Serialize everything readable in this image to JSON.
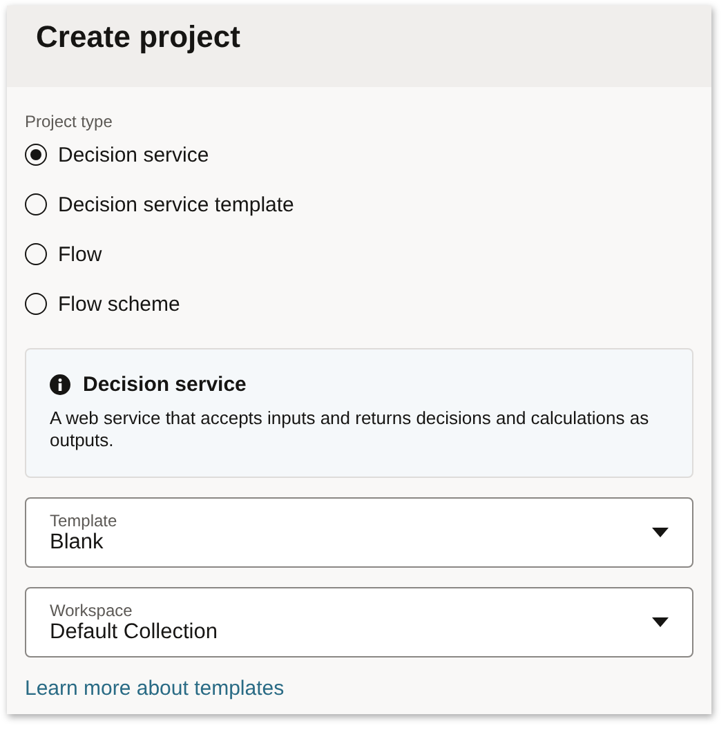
{
  "dialog": {
    "title": "Create project"
  },
  "project_type": {
    "label": "Project type",
    "options": [
      {
        "label": "Decision service",
        "selected": true
      },
      {
        "label": "Decision service template",
        "selected": false
      },
      {
        "label": "Flow",
        "selected": false
      },
      {
        "label": "Flow scheme",
        "selected": false
      }
    ]
  },
  "info": {
    "title": "Decision service",
    "text": "A web service that accepts inputs and returns decisions and calculations as outputs."
  },
  "selects": [
    {
      "label": "Template",
      "value": "Blank"
    },
    {
      "label": "Workspace",
      "value": "Default Collection"
    }
  ],
  "link": "Learn more about templates"
}
